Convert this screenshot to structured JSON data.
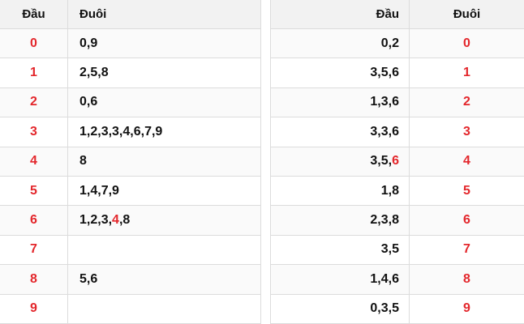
{
  "colors": {
    "highlight": "#e3262b",
    "header_bg": "#f2f2f2",
    "border": "#dcdcdc"
  },
  "left_table": {
    "headers": {
      "dau": "Đầu",
      "duoi": "Đuôi"
    },
    "rows": [
      {
        "dau": "0",
        "duoi": [
          {
            "text": "0,9",
            "red": false
          }
        ]
      },
      {
        "dau": "1",
        "duoi": [
          {
            "text": "2,5,8",
            "red": false
          }
        ]
      },
      {
        "dau": "2",
        "duoi": [
          {
            "text": "0,6",
            "red": false
          }
        ]
      },
      {
        "dau": "3",
        "duoi": [
          {
            "text": "1,2,3,3,4,6,7,9",
            "red": false
          }
        ]
      },
      {
        "dau": "4",
        "duoi": [
          {
            "text": "8",
            "red": false
          }
        ]
      },
      {
        "dau": "5",
        "duoi": [
          {
            "text": "1,4,7,9",
            "red": false
          }
        ]
      },
      {
        "dau": "6",
        "duoi": [
          {
            "text": "1,2,3,",
            "red": false
          },
          {
            "text": "4",
            "red": true
          },
          {
            "text": ",8",
            "red": false
          }
        ]
      },
      {
        "dau": "7",
        "duoi": []
      },
      {
        "dau": "8",
        "duoi": [
          {
            "text": "5,6",
            "red": false
          }
        ]
      },
      {
        "dau": "9",
        "duoi": []
      }
    ]
  },
  "right_table": {
    "headers": {
      "dau": "Đầu",
      "duoi": "Đuôi"
    },
    "rows": [
      {
        "dau": [
          {
            "text": "0,2",
            "red": false
          }
        ],
        "duoi": "0"
      },
      {
        "dau": [
          {
            "text": "3,5,6",
            "red": false
          }
        ],
        "duoi": "1"
      },
      {
        "dau": [
          {
            "text": "1,3,6",
            "red": false
          }
        ],
        "duoi": "2"
      },
      {
        "dau": [
          {
            "text": "3,3,6",
            "red": false
          }
        ],
        "duoi": "3"
      },
      {
        "dau": [
          {
            "text": "3,5,",
            "red": false
          },
          {
            "text": "6",
            "red": true
          }
        ],
        "duoi": "4"
      },
      {
        "dau": [
          {
            "text": "1,8",
            "red": false
          }
        ],
        "duoi": "5"
      },
      {
        "dau": [
          {
            "text": "2,3,8",
            "red": false
          }
        ],
        "duoi": "6"
      },
      {
        "dau": [
          {
            "text": "3,5",
            "red": false
          }
        ],
        "duoi": "7"
      },
      {
        "dau": [
          {
            "text": "1,4,6",
            "red": false
          }
        ],
        "duoi": "8"
      },
      {
        "dau": [
          {
            "text": "0,3,5",
            "red": false
          }
        ],
        "duoi": "9"
      }
    ]
  }
}
